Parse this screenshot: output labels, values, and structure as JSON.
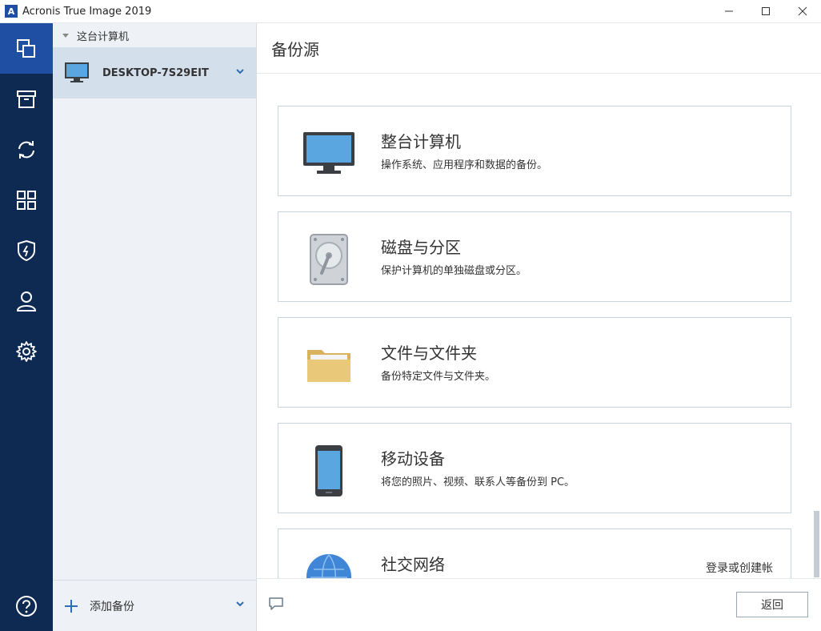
{
  "window": {
    "title": "Acronis True Image 2019",
    "logo_letter": "A"
  },
  "sidebar": {
    "section_label": "这台计算机",
    "device_name": "DESKTOP-7S29EIT",
    "add_backup_label": "添加备份"
  },
  "main": {
    "title": "备份源",
    "cards": [
      {
        "title": "整台计算机",
        "desc": "操作系统、应用程序和数据的备份。"
      },
      {
        "title": "磁盘与分区",
        "desc": "保护计算机的单独磁盘或分区。"
      },
      {
        "title": "文件与文件夹",
        "desc": "备份特定文件与文件夹。"
      },
      {
        "title": "移动设备",
        "desc": "将您的照片、视频、联系人等备份到 PC。"
      },
      {
        "title": "社交网络",
        "link": "登录或创建帐"
      }
    ],
    "back_label": "返回"
  },
  "icons": {
    "rail": [
      "backup-icon",
      "archive-icon",
      "sync-icon",
      "tools-icon",
      "protection-icon",
      "account-icon",
      "settings-icon",
      "help-icon"
    ]
  },
  "colors": {
    "rail_bg": "#0e2a53",
    "rail_active": "#1f4fa3",
    "sidebar_bg": "#eef1f5",
    "device_selected": "#d4dfec"
  }
}
